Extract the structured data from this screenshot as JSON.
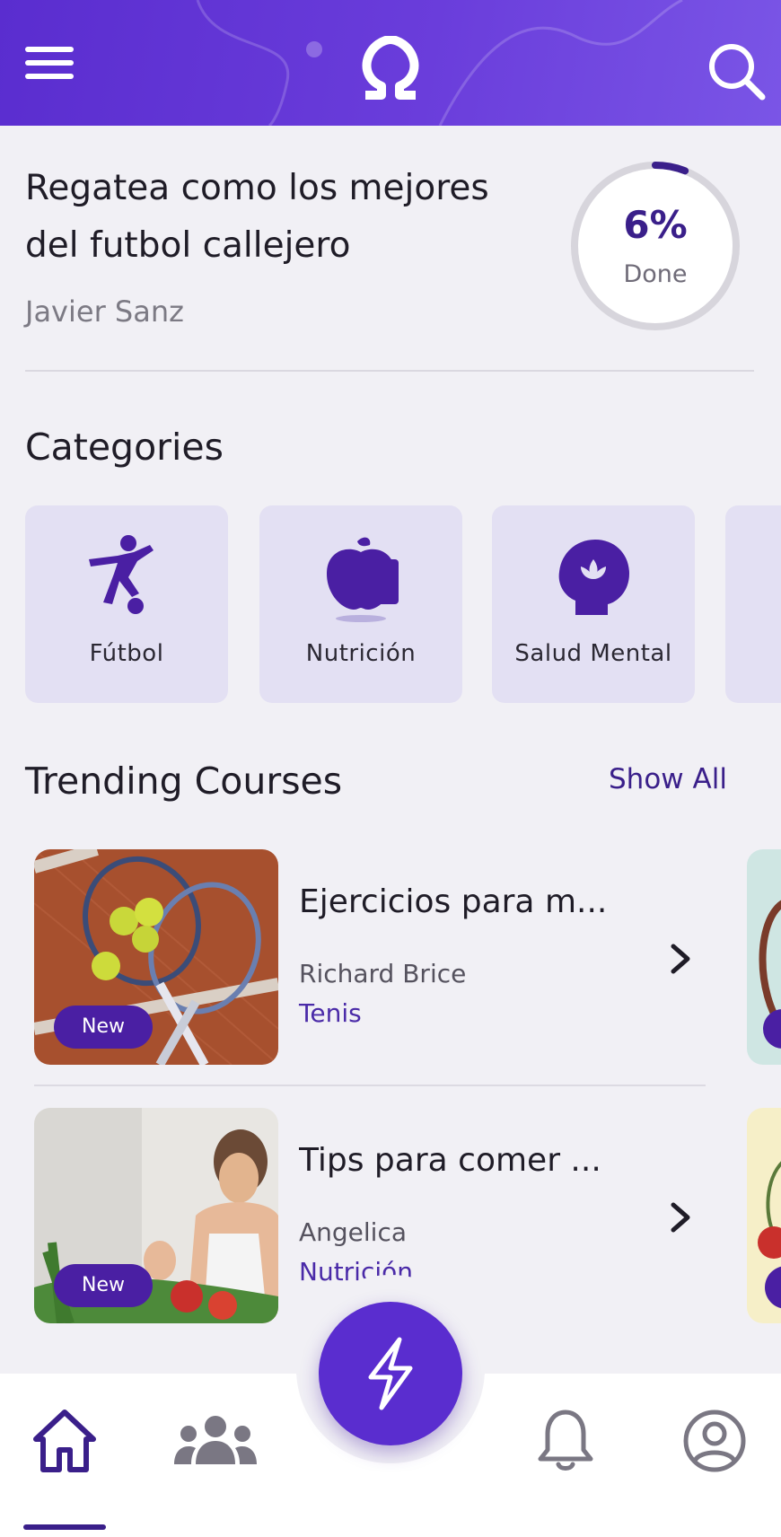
{
  "header": {
    "menu_icon": "menu-icon",
    "logo_icon": "omega-logo",
    "search_icon": "search-icon",
    "brand_color": "#5a2dcf"
  },
  "current_course": {
    "title": "Regatea como los mejores del futbol callejero",
    "author": "Javier Sanz",
    "progress_text": "6%",
    "progress_label": "Done",
    "progress_fraction": 0.06
  },
  "categories": {
    "title": "Categories",
    "items": [
      {
        "label": "Fútbol",
        "icon": "soccer-player-icon"
      },
      {
        "label": "Nutrición",
        "icon": "apple-icon"
      },
      {
        "label": "Salud Mental",
        "icon": "mind-lotus-icon"
      }
    ]
  },
  "trending": {
    "title": "Trending Courses",
    "show_all": "Show All",
    "courses": [
      {
        "title": "Ejercicios para m...",
        "author": "Richard Brice",
        "category": "Tenis",
        "badge": "New"
      },
      {
        "title": "Tips para comer ...",
        "author": "Angelica",
        "category": "Nutrición",
        "badge": "New"
      }
    ]
  },
  "bottom_nav": {
    "items": [
      "home-icon",
      "community-icon",
      "notifications-icon",
      "profile-icon"
    ],
    "fab_icon": "lightning-icon",
    "active": "home-icon"
  }
}
